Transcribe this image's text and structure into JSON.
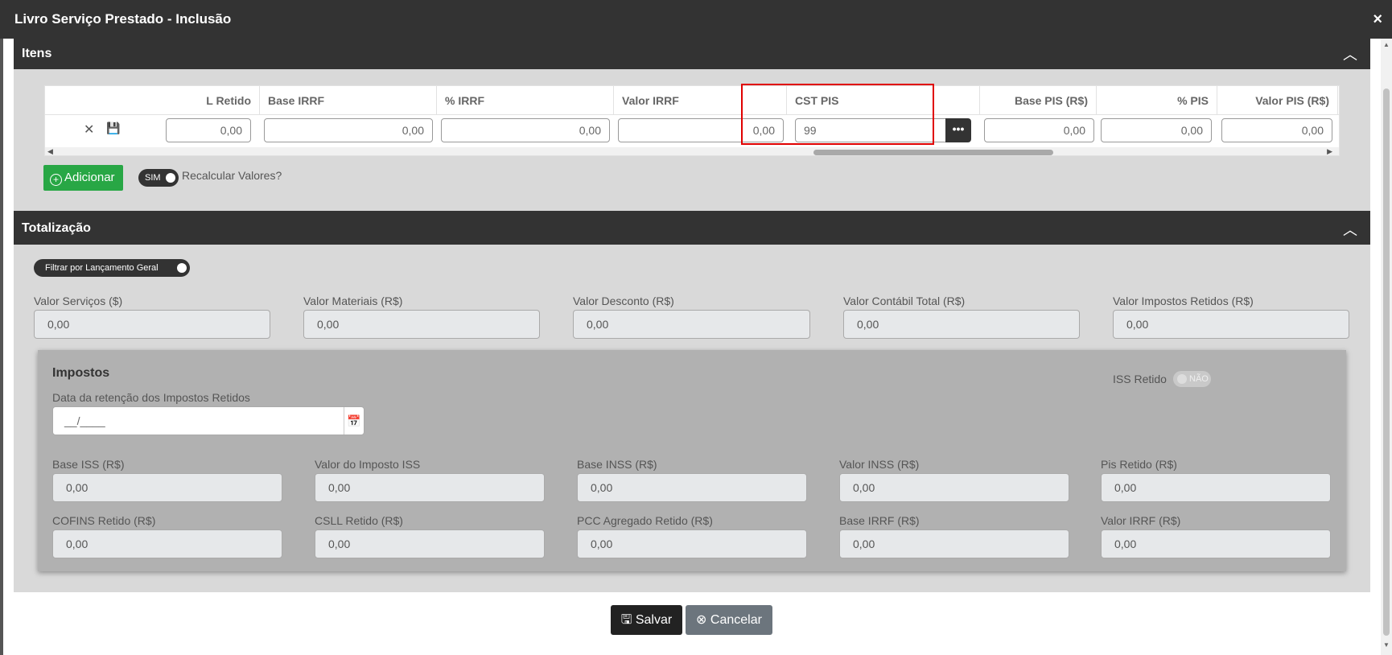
{
  "window": {
    "title": "Livro Serviço Prestado - Inclusão",
    "close_icon": "×"
  },
  "items_section": {
    "title": "Itens",
    "columns": [
      "L Retido",
      "Base IRRF",
      "% IRRF",
      "Valor IRRF",
      "CST PIS",
      "Base PIS (R$)",
      "% PIS",
      "Valor PIS (R$)"
    ],
    "row": {
      "l_retido": "0,00",
      "base_irrf": "0,00",
      "perc_irrf": "0,00",
      "valor_irrf": "0,00",
      "cst_pis": "99",
      "base_pis": "0,00",
      "perc_pis": "0,00",
      "valor_pis": "0,00"
    },
    "add_button": "Adicionar",
    "recalc_toggle": "SIM",
    "recalc_label": "Recalcular Valores?"
  },
  "totals_section": {
    "title": "Totalização",
    "filter_toggle": "Filtrar por Lançamento Geral",
    "fields": [
      {
        "label": "Valor Serviços ($)",
        "value": "0,00"
      },
      {
        "label": "Valor Materiais (R$)",
        "value": "0,00"
      },
      {
        "label": "Valor Desconto (R$)",
        "value": "0,00"
      },
      {
        "label": "Valor Contábil Total (R$)",
        "value": "0,00"
      },
      {
        "label": "Valor Impostos Retidos (R$)",
        "value": "0,00"
      }
    ]
  },
  "impostos": {
    "title": "Impostos",
    "date_label": "Data da retenção dos Impostos Retidos",
    "date_placeholder": "__/____",
    "iss_label": "ISS Retido",
    "iss_toggle": "NÃO",
    "fields": [
      {
        "label": "Base ISS (R$)",
        "value": "0,00"
      },
      {
        "label": "Valor do Imposto ISS",
        "value": "0,00"
      },
      {
        "label": "Base INSS (R$)",
        "value": "0,00"
      },
      {
        "label": "Valor INSS (R$)",
        "value": "0,00"
      },
      {
        "label": "Pis Retido (R$)",
        "value": "0,00"
      },
      {
        "label": "COFINS Retido (R$)",
        "value": "0,00"
      },
      {
        "label": "CSLL Retido (R$)",
        "value": "0,00"
      },
      {
        "label": "PCC Agregado Retido (R$)",
        "value": "0,00"
      },
      {
        "label": "Base IRRF (R$)",
        "value": "0,00"
      },
      {
        "label": "Valor IRRF (R$)",
        "value": "0,00"
      }
    ]
  },
  "footer": {
    "save": "Salvar",
    "cancel": "Cancelar"
  },
  "colors": {
    "header_bg": "#333333",
    "panel_bg": "#d9d9d9",
    "add_green": "#28a745",
    "highlight_red": "#e00000",
    "cancel_gray": "#6c757d"
  }
}
